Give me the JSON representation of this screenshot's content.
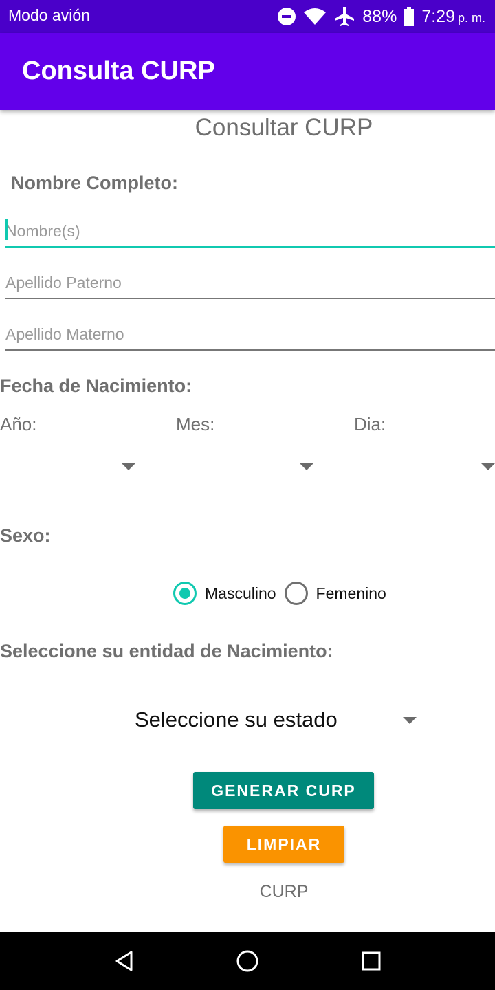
{
  "status_bar": {
    "left_text": "Modo avión",
    "battery": "88%",
    "time": "7:29",
    "ampm": "p. m."
  },
  "app_bar": {
    "title": "Consulta CURP"
  },
  "heading": "Consultar CURP",
  "nombre_completo": {
    "label": "Nombre Completo:",
    "nombre_placeholder": "Nombre(s)",
    "paterno_placeholder": "Apellido Paterno",
    "materno_placeholder": "Apellido Materno"
  },
  "fecha": {
    "label": "Fecha de Nacimiento:",
    "anio_label": "Año:",
    "mes_label": "Mes:",
    "dia_label": "Dia:"
  },
  "sexo": {
    "label": "Sexo:",
    "options": [
      "Masculino",
      "Femenino"
    ],
    "selected": "Masculino"
  },
  "entidad": {
    "label": "Seleccione su entidad de Nacimiento:",
    "select_value": "Seleccione su estado"
  },
  "buttons": {
    "generar": "GENERAR CURP",
    "limpiar": "LIMPIAR"
  },
  "result": {
    "text": "CURP"
  },
  "colors": {
    "status_bar": "#4a00c9",
    "app_bar": "#6200ea",
    "accent": "#10c9b0",
    "generar": "#00897b",
    "limpiar": "#fa9300"
  }
}
